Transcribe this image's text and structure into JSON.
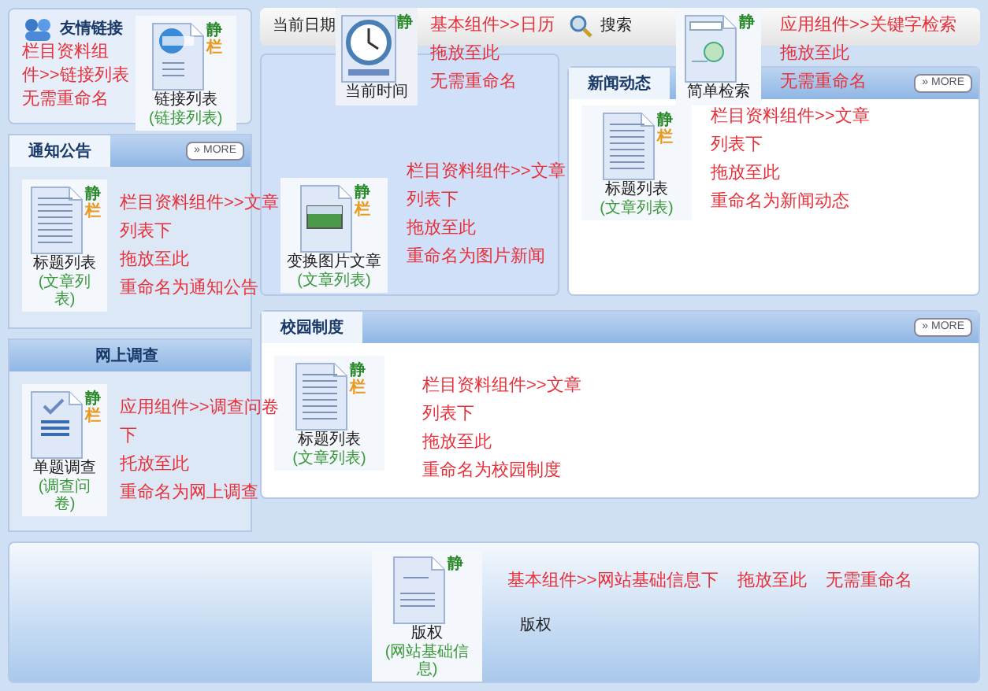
{
  "links_panel": {
    "header": "友情链接",
    "widget": {
      "title": "链接列表",
      "subtitle": "(链接列表)",
      "badges": [
        "静",
        "栏"
      ]
    },
    "notes": [
      "栏目资料组",
      "件>>链接列表",
      "无需重命名"
    ]
  },
  "notice_panel": {
    "header": "通知公告",
    "more": "» MORE",
    "widget": {
      "title": "标题列表",
      "subtitle": "(文章列表)",
      "badges": [
        "静",
        "栏"
      ]
    },
    "notes": [
      "栏目资料组件>>文章",
      "列表下",
      "拖放至此",
      "重命名为通知公告"
    ]
  },
  "survey_panel": {
    "header": "网上调查",
    "widget": {
      "title": "单题调查",
      "subtitle": "(调查问卷)",
      "badges": [
        "静",
        "栏"
      ]
    },
    "notes": [
      "应用组件>>调查问卷",
      "下",
      "托放至此",
      "重命名为网上调查"
    ]
  },
  "top_bar": {
    "date_label": "当前日期",
    "clock_widget": {
      "title": "当前时间",
      "badges": [
        "静"
      ]
    },
    "clock_notes": [
      "基本组件>>日历",
      "拖放至此",
      "无需重命名"
    ],
    "search_label": "搜索",
    "search_widget": {
      "title": "简单检索",
      "badges": [
        "静"
      ]
    },
    "search_notes": [
      "应用组件>>关键字检索",
      "拖放至此",
      "无需重命名"
    ]
  },
  "picture_panel": {
    "widget": {
      "title": "变换图片文章",
      "subtitle": "(文章列表)",
      "badges": [
        "静",
        "栏"
      ]
    },
    "notes": [
      "栏目资料组件>>文章",
      "列表下",
      "拖放至此",
      "重命名为图片新闻"
    ]
  },
  "news_panel": {
    "header": "新闻动态",
    "more": "» MORE",
    "widget": {
      "title": "标题列表",
      "subtitle": "(文章列表)",
      "badges": [
        "静",
        "栏"
      ]
    },
    "notes": [
      "栏目资料组件>>文章",
      "列表下",
      "拖放至此",
      "重命名为新闻动态"
    ]
  },
  "campus_panel": {
    "header": "校园制度",
    "more": "» MORE",
    "widget": {
      "title": "标题列表",
      "subtitle": "(文章列表)",
      "badges": [
        "静",
        "栏"
      ]
    },
    "notes": [
      "栏目资料组件>>文章",
      "列表下",
      "拖放至此",
      "重命名为校园制度"
    ]
  },
  "footer": {
    "widget": {
      "title": "版权",
      "subtitle": "(网站基础信息)",
      "badges": [
        "静"
      ]
    },
    "notes": [
      "基本组件>>网站基础信息下",
      "拖放至此",
      "无需重命名"
    ],
    "text": "版权"
  }
}
